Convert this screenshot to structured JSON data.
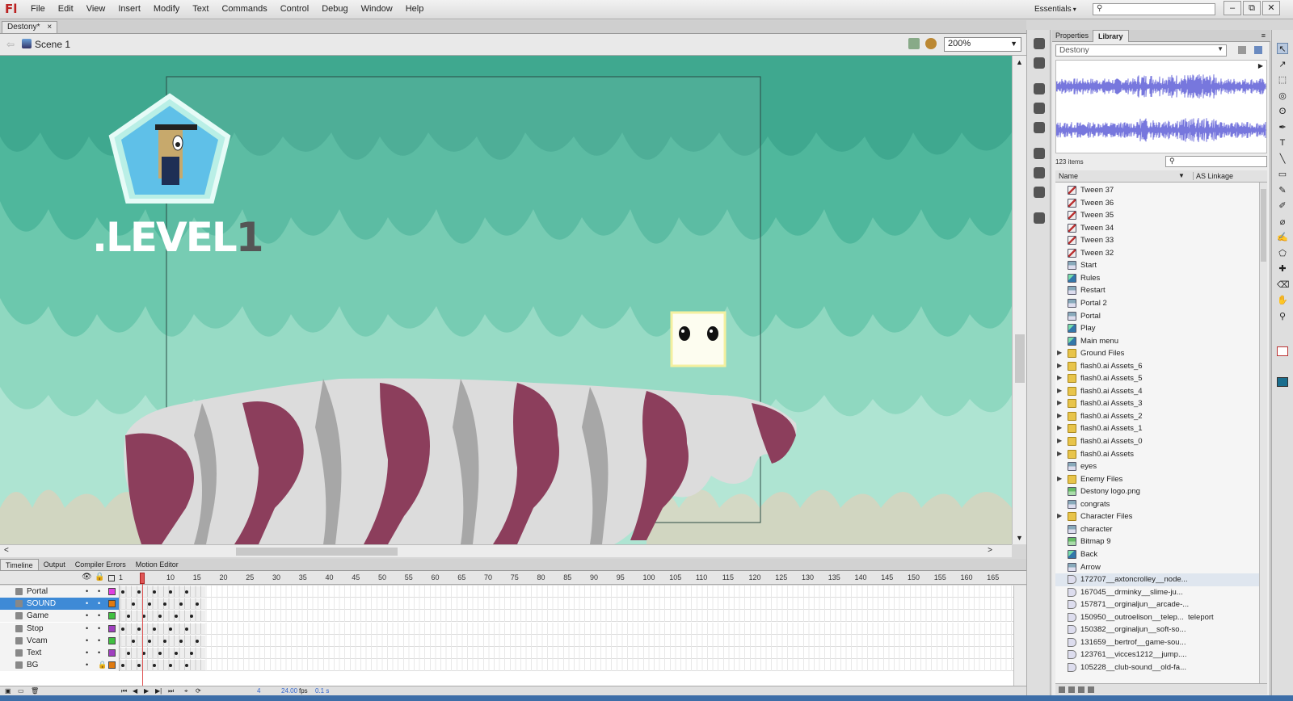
{
  "app": {
    "logo": "Fl"
  },
  "menu": [
    "File",
    "Edit",
    "View",
    "Insert",
    "Modify",
    "Text",
    "Commands",
    "Control",
    "Debug",
    "Window",
    "Help"
  ],
  "workspace": "Essentials",
  "window_controls": [
    "–",
    "⧉",
    "✕"
  ],
  "document_tab": {
    "title": "Destony*",
    "close": "×"
  },
  "editbar": {
    "scene": "Scene 1",
    "zoom": "200%"
  },
  "stage": {
    "level_prefix": ".LEVEL",
    "level_number": "1",
    "background_color": "#9ad9c3"
  },
  "timeline": {
    "tabs": [
      "Timeline",
      "Output",
      "Compiler Errors",
      "Motion Editor"
    ],
    "ruler": [
      "1",
      "5",
      "10",
      "15",
      "20",
      "25",
      "30",
      "35",
      "40",
      "45",
      "50",
      "55",
      "60",
      "65",
      "70",
      "75",
      "80",
      "85",
      "90",
      "95",
      "100",
      "105",
      "110",
      "115",
      "120",
      "125",
      "130",
      "135",
      "140",
      "145",
      "150",
      "155",
      "160",
      "165"
    ],
    "current_frame": 5,
    "layers": [
      {
        "name": "Portal",
        "color": "#e040e0",
        "selected": false,
        "locked": false
      },
      {
        "name": "SOUND",
        "color": "#e07a10",
        "selected": true,
        "locked": false
      },
      {
        "name": "Game",
        "color": "#40c040",
        "selected": false,
        "locked": false
      },
      {
        "name": "Stop",
        "color": "#a040c0",
        "selected": false,
        "locked": false
      },
      {
        "name": "Vcam",
        "color": "#40c040",
        "selected": false,
        "locked": false
      },
      {
        "name": "Text",
        "color": "#a040c0",
        "selected": false,
        "locked": false
      },
      {
        "name": "BG",
        "color": "#e07a10",
        "selected": false,
        "locked": true
      }
    ],
    "footer": {
      "frame": "4",
      "fps": "24.00",
      "fps_unit": "fps",
      "time": "0.1 s"
    }
  },
  "library": {
    "tabs": [
      "Properties",
      "Library"
    ],
    "document": "Destony",
    "count": "123 items",
    "columns": [
      "Name",
      "AS Linkage"
    ],
    "items": [
      {
        "name": "Tween 37",
        "type": "graphic",
        "folder": false,
        "linkage": ""
      },
      {
        "name": "Tween 36",
        "type": "graphic",
        "folder": false,
        "linkage": ""
      },
      {
        "name": "Tween 35",
        "type": "graphic",
        "folder": false,
        "linkage": ""
      },
      {
        "name": "Tween 34",
        "type": "graphic",
        "folder": false,
        "linkage": ""
      },
      {
        "name": "Tween 33",
        "type": "graphic",
        "folder": false,
        "linkage": ""
      },
      {
        "name": "Tween 32",
        "type": "graphic",
        "folder": false,
        "linkage": ""
      },
      {
        "name": "Start",
        "type": "button",
        "folder": false,
        "linkage": ""
      },
      {
        "name": "Rules",
        "type": "movie",
        "folder": false,
        "linkage": ""
      },
      {
        "name": "Restart",
        "type": "button",
        "folder": false,
        "linkage": ""
      },
      {
        "name": "Portal 2",
        "type": "button",
        "folder": false,
        "linkage": ""
      },
      {
        "name": "Portal",
        "type": "button",
        "folder": false,
        "linkage": ""
      },
      {
        "name": "Play",
        "type": "movie",
        "folder": false,
        "linkage": ""
      },
      {
        "name": "Main menu",
        "type": "movie",
        "folder": false,
        "linkage": ""
      },
      {
        "name": "Ground Files",
        "type": "folder",
        "folder": true,
        "linkage": ""
      },
      {
        "name": "flash0.ai Assets_6",
        "type": "folder",
        "folder": true,
        "linkage": ""
      },
      {
        "name": "flash0.ai Assets_5",
        "type": "folder",
        "folder": true,
        "linkage": ""
      },
      {
        "name": "flash0.ai Assets_4",
        "type": "folder",
        "folder": true,
        "linkage": ""
      },
      {
        "name": "flash0.ai Assets_3",
        "type": "folder",
        "folder": true,
        "linkage": ""
      },
      {
        "name": "flash0.ai Assets_2",
        "type": "folder",
        "folder": true,
        "linkage": ""
      },
      {
        "name": "flash0.ai Assets_1",
        "type": "folder",
        "folder": true,
        "linkage": ""
      },
      {
        "name": "flash0.ai Assets_0",
        "type": "folder",
        "folder": true,
        "linkage": ""
      },
      {
        "name": "flash0.ai Assets",
        "type": "folder",
        "folder": true,
        "linkage": ""
      },
      {
        "name": "eyes",
        "type": "button",
        "folder": false,
        "linkage": ""
      },
      {
        "name": "Enemy Files",
        "type": "folder",
        "folder": true,
        "linkage": ""
      },
      {
        "name": "Destony logo.png",
        "type": "bitmap",
        "folder": false,
        "linkage": ""
      },
      {
        "name": "congrats",
        "type": "button",
        "folder": false,
        "linkage": ""
      },
      {
        "name": "Character Files",
        "type": "folder",
        "folder": true,
        "linkage": ""
      },
      {
        "name": "character",
        "type": "button",
        "folder": false,
        "linkage": ""
      },
      {
        "name": "Bitmap 9",
        "type": "bitmap",
        "folder": false,
        "linkage": ""
      },
      {
        "name": "Back",
        "type": "movie",
        "folder": false,
        "linkage": ""
      },
      {
        "name": "Arrow",
        "type": "button",
        "folder": false,
        "linkage": ""
      },
      {
        "name": "172707__axtoncrolley__node...",
        "type": "sound",
        "folder": false,
        "linkage": ""
      },
      {
        "name": "167045__drminky__slime-ju...",
        "type": "sound",
        "folder": false,
        "linkage": ""
      },
      {
        "name": "157871__orginaljun__arcade-...",
        "type": "sound",
        "folder": false,
        "linkage": ""
      },
      {
        "name": "150950__outroelison__telep...",
        "type": "sound",
        "folder": false,
        "linkage": "teleport"
      },
      {
        "name": "150382__orginaljun__soft-so...",
        "type": "sound",
        "folder": false,
        "linkage": ""
      },
      {
        "name": "131659__bertrof__game-sou...",
        "type": "sound",
        "folder": false,
        "linkage": ""
      },
      {
        "name": "123761__vicces1212__jump....",
        "type": "sound",
        "folder": false,
        "linkage": ""
      },
      {
        "name": "105228__club-sound__old-fa...",
        "type": "sound",
        "folder": false,
        "linkage": ""
      }
    ]
  },
  "tools": [
    "↖",
    "↗",
    "⬚",
    "◎",
    "ʘ",
    "✒",
    "T",
    "╲",
    "▭",
    "✎",
    "✐",
    "⌀",
    "✍",
    "⬠",
    "✚",
    "⌫",
    "✋",
    "⚲"
  ]
}
